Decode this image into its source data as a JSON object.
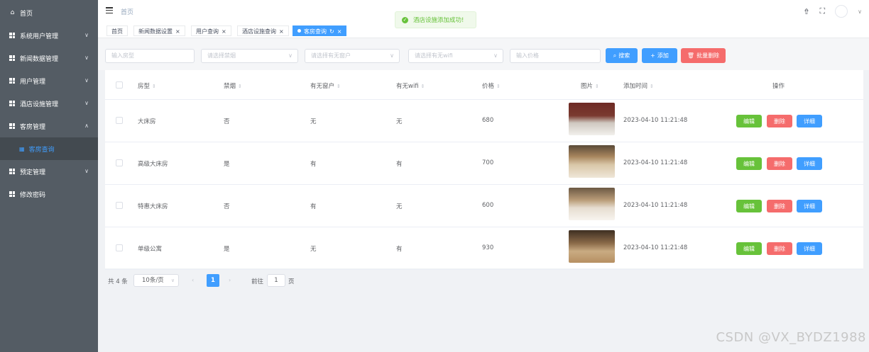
{
  "sidebar": {
    "items": [
      {
        "label": "首页",
        "icon": "home-icon",
        "expandable": false
      },
      {
        "label": "系统用户管理",
        "icon": "grid-icon",
        "expandable": true
      },
      {
        "label": "新闻数据管理",
        "icon": "grid-icon",
        "expandable": true
      },
      {
        "label": "用户管理",
        "icon": "grid-icon",
        "expandable": true
      },
      {
        "label": "酒店设施管理",
        "icon": "grid-icon",
        "expandable": true
      },
      {
        "label": "客房管理",
        "icon": "grid-icon",
        "expandable": true,
        "open": true
      },
      {
        "label": "预定管理",
        "icon": "grid-icon",
        "expandable": true
      },
      {
        "label": "修改密码",
        "icon": "grid-icon",
        "expandable": false
      }
    ],
    "sub_active": {
      "label": "客房查询",
      "icon": "grid-icon"
    }
  },
  "header": {
    "breadcrumb": "首页",
    "icons": [
      "shirt-icon",
      "fullscreen-icon",
      "avatar",
      "chevron-down-icon"
    ]
  },
  "tags": [
    {
      "label": "首页",
      "closable": false,
      "active": false
    },
    {
      "label": "新闻数据设置",
      "closable": true,
      "active": false
    },
    {
      "label": "用户查询",
      "closable": true,
      "active": false
    },
    {
      "label": "酒店设施查询",
      "closable": true,
      "active": false
    },
    {
      "label": "客房查询",
      "closable": true,
      "active": true
    }
  ],
  "toast": {
    "text": "酒店设施添加成功!",
    "color": "#67c23a"
  },
  "search": {
    "room_type_placeholder": "输入房型",
    "smoking_placeholder": "请选择禁烟",
    "window_placeholder": "请选择有无窗户",
    "wifi_placeholder": "请选择有无wifi",
    "price_placeholder": "输入价格",
    "search_label": "搜索",
    "add_label": "添加",
    "batch_delete_label": "批量删除"
  },
  "table": {
    "headers": [
      "房型",
      "禁烟",
      "有无窗户",
      "有无wifi",
      "价格",
      "图片",
      "添加时间",
      "操作"
    ],
    "rows": [
      {
        "room_type": "大床房",
        "smoking": "否",
        "window": "无",
        "wifi": "无",
        "price": "680",
        "added": "2023-04-10 11:21:48"
      },
      {
        "room_type": "高级大床房",
        "smoking": "是",
        "window": "有",
        "wifi": "有",
        "price": "700",
        "added": "2023-04-10 11:21:48"
      },
      {
        "room_type": "特惠大床房",
        "smoking": "否",
        "window": "有",
        "wifi": "无",
        "price": "600",
        "added": "2023-04-10 11:21:48"
      },
      {
        "room_type": "单级公寓",
        "smoking": "是",
        "window": "无",
        "wifi": "有",
        "price": "930",
        "added": "2023-04-10 11:21:48"
      }
    ],
    "actions": {
      "edit": "编辑",
      "delete": "删除",
      "detail": "详细"
    }
  },
  "pagination": {
    "total": "共 4 条",
    "page_size": "10条/页",
    "current_page": "1",
    "goto_label": "前往",
    "goto_value": "1",
    "page_suffix": "页"
  },
  "watermark": "CSDN @VX_BYDZ1988",
  "colors": {
    "primary": "#409eff",
    "danger": "#f56c6c",
    "success": "#67c23a",
    "sidebar": "#545c64"
  }
}
